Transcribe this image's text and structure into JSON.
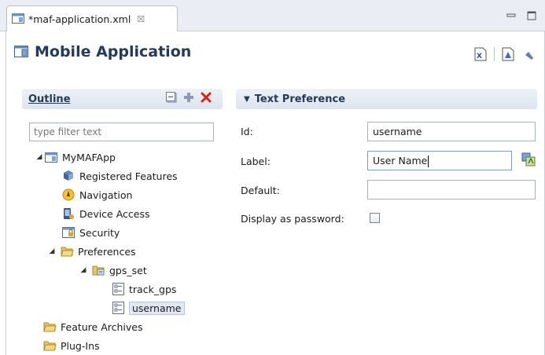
{
  "tab": {
    "title": "*maf-application.xml",
    "close_glyph": "☒"
  },
  "window_controls": {
    "minimize": "▭",
    "maximize": "☐"
  },
  "header": {
    "title": "Mobile Application"
  },
  "outline": {
    "title": "Outline",
    "filter_placeholder": "type filter text",
    "tree": [
      {
        "label": "MyMAFApp",
        "icon": "application-icon"
      },
      {
        "label": "Registered Features",
        "icon": "features-icon"
      },
      {
        "label": "Navigation",
        "icon": "navigation-icon"
      },
      {
        "label": "Device Access",
        "icon": "device-access-icon"
      },
      {
        "label": "Security",
        "icon": "security-icon"
      },
      {
        "label": "Preferences",
        "icon": "folder-open-icon"
      },
      {
        "label": "gps_set",
        "icon": "preference-group-icon"
      },
      {
        "label": "track_gps",
        "icon": "preference-item-icon"
      },
      {
        "label": "username",
        "icon": "preference-item-icon"
      },
      {
        "label": "Feature Archives",
        "icon": "folder-icon"
      },
      {
        "label": "Plug-Ins",
        "icon": "folder-icon"
      }
    ]
  },
  "text_preference": {
    "title": "Text Preference",
    "id_label": "Id:",
    "id_value": "username",
    "label_label": "Label:",
    "label_value": "User Name",
    "default_label": "Default:",
    "default_value": "",
    "password_label": "Display as password:",
    "password_checked": false
  }
}
